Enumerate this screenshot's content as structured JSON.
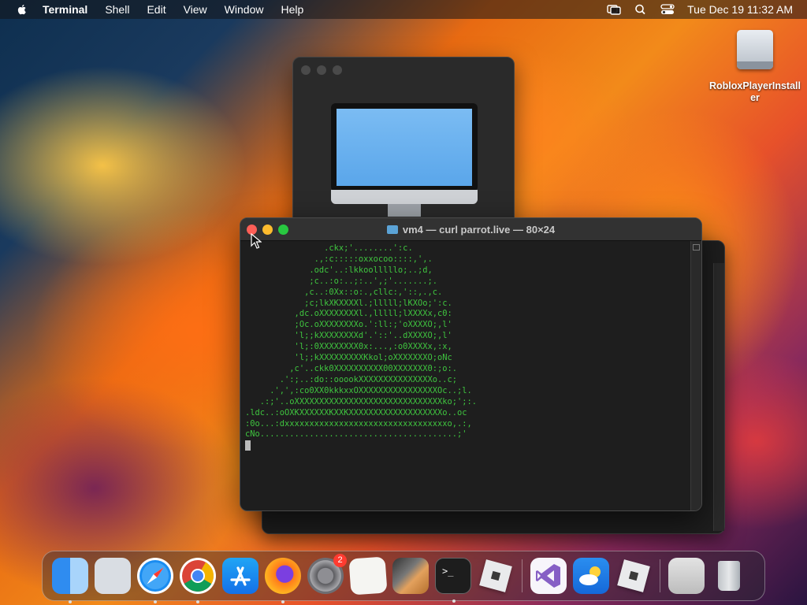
{
  "menubar": {
    "app_name": "Terminal",
    "menus": [
      "Shell",
      "Edit",
      "View",
      "Window",
      "Help"
    ],
    "clock": "Tue Dec 19  11:32 AM"
  },
  "desktop": {
    "icons": [
      {
        "label": "RobloxPlayerInstaller",
        "icon": "disk-image-icon"
      }
    ]
  },
  "terminal": {
    "title": "vm4 — curl parrot.live — 80×24",
    "text_color": "#3fc43f",
    "lines": [
      "                .ckx;'........':c.",
      "              .,:c:::::oxxocoo::::,',.",
      "             .odc'..:lkkoolllllo;..;d,",
      "             ;c..:o:..;:..',;'.......;.",
      "            ,c..:0Xx::o:.,cllc:,'::,.,c.",
      "            ;c;lkXKXXXXl.;lllll;lKXOo;':c.",
      "          ,dc.oXXXXXXXXl.,lllll;lXXXXx,c0:",
      "          ;Oc.oXXXXXXXXo.':ll:;'oXXXXO;,l'",
      "          'l;;kXXXXXXXXd'.'::'..dXXXXO;,l'",
      "          'l;:0XXXXXXXX0x:...,:o0XXXXx,:x,",
      "          'l;;kXXXXXXXXXKkol;oXXXXXXXO;oNc",
      "         ,c'..ckk0XXXXXXXXXX00XXXXXXX0:;o:.",
      "       .':;..:do::ooookXXXXXXXXXXXXXXXo..c;",
      "     .',',:co0XX0kkkxxOXXXXXXXXXXXXXXXXOc..;l.",
      "   .:;'..oXXXXXXXXXXXXXXXXXXXXXXXXXXXXXXko;';:.",
      ".ldc..:oOXKXXXXXXKXXKXXXXXXXXXXXXXXXXXXXo..oc",
      ":0o...:dxxxxxxxxxxxxxxxxxxxxxxxxxxxxxxxxxo,.:,",
      "cNo........................................;'"
    ]
  },
  "dock": {
    "items": [
      {
        "name": "finder",
        "running": true
      },
      {
        "name": "launchpad",
        "running": false
      },
      {
        "name": "safari",
        "running": true
      },
      {
        "name": "chrome",
        "running": true
      },
      {
        "name": "app-store",
        "running": false
      },
      {
        "name": "firefox",
        "running": true
      },
      {
        "name": "system-settings",
        "running": false,
        "badge": "2"
      },
      {
        "name": "textedit",
        "running": false
      },
      {
        "name": "garageband",
        "running": false
      },
      {
        "name": "terminal",
        "running": true,
        "prompt": ">_"
      },
      {
        "name": "roblox-studio",
        "running": false
      },
      {
        "name": "visual-studio",
        "running": false
      },
      {
        "name": "weather",
        "running": false
      },
      {
        "name": "roblox-player",
        "running": false
      },
      {
        "name": "preview",
        "running": false
      },
      {
        "name": "trash",
        "running": false
      }
    ]
  },
  "colors": {
    "close": "#ff5f57",
    "minimize": "#febc2e",
    "zoom": "#28c840",
    "badge": "#ff3b30"
  }
}
